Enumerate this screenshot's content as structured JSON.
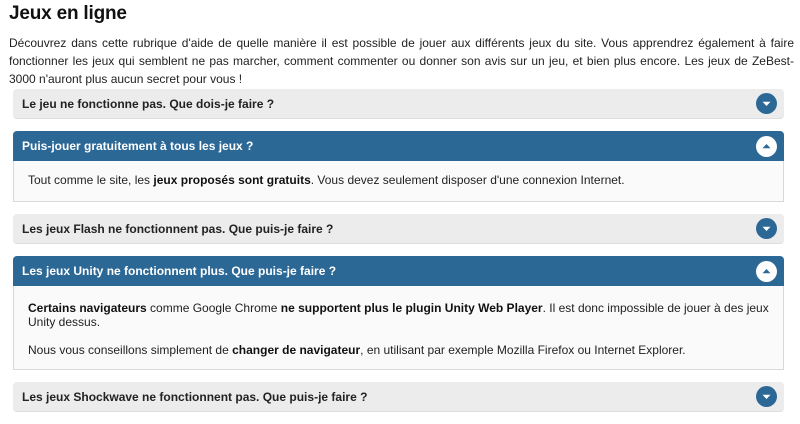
{
  "page": {
    "title": "Jeux en ligne",
    "intro": "Découvrez dans cette rubrique d'aide de quelle manière il est possible de jouer aux différents jeux du site. Vous apprendrez également à faire fonctionner les jeux qui semblent ne pas marcher, comment commenter ou donner son avis sur un jeu, et bien plus encore. Les jeux de ZeBest-3000 n'auront plus aucun secret pour vous !"
  },
  "faq": [
    {
      "question": "Le jeu ne fonctionne pas. Que dois-je faire ?",
      "state": "collapsed",
      "toggle_icon": "chevron-down-icon"
    },
    {
      "question": "Puis-jouer gratuitement à tous les jeux ?",
      "state": "expanded",
      "toggle_icon": "chevron-up-icon",
      "answer": {
        "part1": "Tout comme le site, les ",
        "part2_bold": "jeux proposés sont gratuits",
        "part3": ". Vous devez seulement disposer d'une connexion Internet."
      }
    },
    {
      "question": "Les jeux Flash ne fonctionnent pas. Que puis-je faire ?",
      "state": "collapsed",
      "toggle_icon": "chevron-down-icon"
    },
    {
      "question": "Les jeux Unity ne fonctionnent plus. Que puis-je faire ?",
      "state": "expanded",
      "toggle_icon": "chevron-up-icon",
      "answer": {
        "p1_bold1": "Certains navigateurs",
        "p1_text1": " comme Google Chrome ",
        "p1_bold2": "ne supportent plus le plugin Unity Web Player",
        "p1_text2": ". Il est donc impossible de jouer à des jeux Unity dessus.",
        "p2_text1": "Nous vous conseillons simplement de ",
        "p2_bold": "changer de navigateur",
        "p2_text2": ", en utilisant par exemple Mozilla Firefox ou Internet Explorer."
      }
    },
    {
      "question": "Les jeux Shockwave ne fonctionnent pas. Que puis-je faire ?",
      "state": "collapsed",
      "toggle_icon": "chevron-down-icon"
    }
  ],
  "colors": {
    "accent": "#2c6896",
    "closed_header_bg": "#ececec",
    "answer_bg": "#fafafa"
  }
}
